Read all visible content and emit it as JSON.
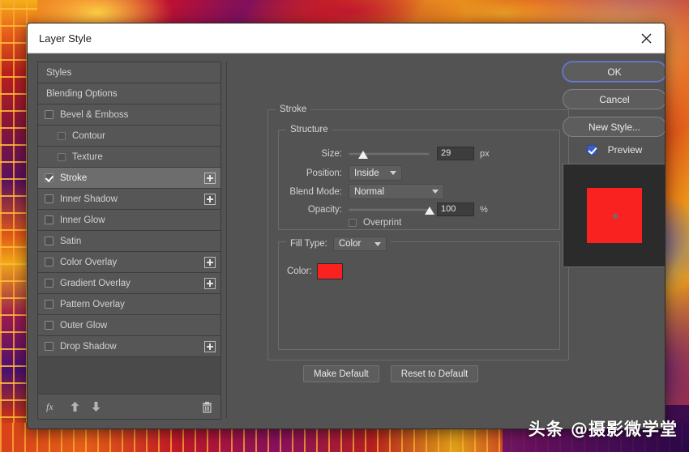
{
  "window": {
    "title": "Layer Style",
    "close_icon": "close-icon"
  },
  "sidebar": {
    "items": [
      {
        "label": "Styles",
        "type": "plain",
        "checkbox": null,
        "plus": false,
        "selected": false,
        "indent": false
      },
      {
        "label": "Blending Options",
        "type": "plain",
        "checkbox": null,
        "plus": false,
        "selected": false,
        "indent": false
      },
      {
        "label": "Bevel & Emboss",
        "type": "check",
        "checkbox": false,
        "plus": false,
        "selected": false,
        "indent": false
      },
      {
        "label": "Contour",
        "type": "check",
        "checkbox": false,
        "plus": false,
        "selected": false,
        "indent": true
      },
      {
        "label": "Texture",
        "type": "check",
        "checkbox": false,
        "plus": false,
        "selected": false,
        "indent": true
      },
      {
        "label": "Stroke",
        "type": "check",
        "checkbox": true,
        "plus": true,
        "selected": true,
        "indent": false
      },
      {
        "label": "Inner Shadow",
        "type": "check",
        "checkbox": false,
        "plus": true,
        "selected": false,
        "indent": false
      },
      {
        "label": "Inner Glow",
        "type": "check",
        "checkbox": false,
        "plus": false,
        "selected": false,
        "indent": false
      },
      {
        "label": "Satin",
        "type": "check",
        "checkbox": false,
        "plus": false,
        "selected": false,
        "indent": false
      },
      {
        "label": "Color Overlay",
        "type": "check",
        "checkbox": false,
        "plus": true,
        "selected": false,
        "indent": false
      },
      {
        "label": "Gradient Overlay",
        "type": "check",
        "checkbox": false,
        "plus": true,
        "selected": false,
        "indent": false
      },
      {
        "label": "Pattern Overlay",
        "type": "check",
        "checkbox": false,
        "plus": false,
        "selected": false,
        "indent": false
      },
      {
        "label": "Outer Glow",
        "type": "check",
        "checkbox": false,
        "plus": false,
        "selected": false,
        "indent": false
      },
      {
        "label": "Drop Shadow",
        "type": "check",
        "checkbox": false,
        "plus": true,
        "selected": false,
        "indent": false
      }
    ],
    "footer": {
      "fx_icon": "fx-icon",
      "fx_label": "fx",
      "up_icon": "arrow-up-icon",
      "down_icon": "arrow-down-icon",
      "delete_icon": "trash-icon"
    }
  },
  "main": {
    "stroke_legend": "Stroke",
    "structure_legend": "Structure",
    "size": {
      "label": "Size:",
      "value": "29",
      "unit": "px",
      "percent": 18
    },
    "position": {
      "label": "Position:",
      "value": "Inside"
    },
    "blend_mode": {
      "label": "Blend Mode:",
      "value": "Normal"
    },
    "opacity": {
      "label": "Opacity:",
      "value": "100",
      "unit": "%",
      "percent": 100
    },
    "overprint": {
      "label": "Overprint",
      "checked": false
    },
    "fill_type": {
      "label": "Fill Type:",
      "value": "Color"
    },
    "color": {
      "label": "Color:",
      "swatch_hex": "#FA2121"
    },
    "make_default_label": "Make Default",
    "reset_default_label": "Reset to Default"
  },
  "right": {
    "ok_label": "OK",
    "cancel_label": "Cancel",
    "new_style_label": "New Style...",
    "preview_label": "Preview",
    "preview_checked": true,
    "thumbnail": {
      "background_hex": "#2B2B2B",
      "square_hex": "#FA2121",
      "dot_hex": "#6D6D6D"
    }
  },
  "watermark": {
    "text": "头条 @摄影微学堂"
  }
}
